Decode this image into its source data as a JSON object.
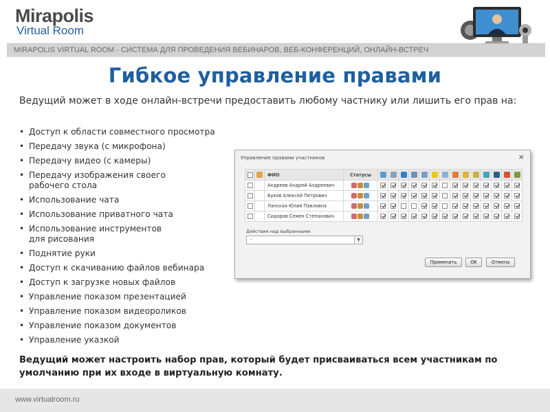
{
  "logo": {
    "line1": "Mirapolis",
    "line2": "Virtual Room"
  },
  "banner": "MIRAPOLIS VIRTUAL ROOM - СИСТЕМА ДЛЯ ПРОВЕДЕНИЯ ВЕБИНАРОВ, ВЕБ-КОНФЕРЕНЦИЙ, ОНЛАЙН-ВСТРЕЧ",
  "title": "Гибкое управление правами",
  "intro": "Ведущий может в ходе онлайн-встречи предоставить любому частнику или лишить его прав на:",
  "bullets": [
    "Доступ к области совместного просмотра",
    "Передачу звука (с микрофона)",
    "Передачу видео (с камеры)",
    "Передачу изображения своего\nрабочего стола",
    "Использование чата",
    "Использование приватного чата",
    "Использование инструментов\nдля рисования",
    "Поднятие руки",
    "Доступ к скачиванию файлов вебинара",
    "Доступ к загрузке новых файлов",
    "Управление показом презентацией",
    "Управление показом видеороликов",
    "Управление показом документов",
    "Управление указкой"
  ],
  "outro": "Ведущий может настроить набор прав, который будет присваиваться всем участникам по умолчанию при их входе в виртуальную комнату.",
  "footer": "www.virtualroom.ru",
  "dialog": {
    "title": "Управление правами участников",
    "close": "×",
    "col_name": "ФИО",
    "col_status": "Статусы",
    "header_icon_colors": [
      "#5b9bd5",
      "#8aa0b8",
      "#3b7dc4",
      "#6f93b8",
      "#7a9cc0",
      "#f0c419",
      "#8db0d6",
      "#e07b39",
      "#e3b236",
      "#c8b04a",
      "#4aa0c0",
      "#2f5d8a",
      "#d9532c",
      "#7a9c3c"
    ],
    "status_icon_colors": [
      "#d06a6a",
      "#c98b3a",
      "#6fa0c8"
    ],
    "rows": [
      {
        "name": "Андреев Андрей Андреевич",
        "checks": [
          1,
          1,
          1,
          1,
          1,
          1,
          0,
          1,
          1,
          1,
          1,
          1,
          1,
          1
        ]
      },
      {
        "name": "Буков Алексей Петрович",
        "checks": [
          1,
          1,
          1,
          1,
          1,
          1,
          0,
          1,
          1,
          1,
          1,
          1,
          1,
          1
        ]
      },
      {
        "name": "Ланская Юлия Павловна",
        "checks": [
          1,
          1,
          0,
          0,
          1,
          1,
          0,
          1,
          1,
          1,
          1,
          1,
          1,
          1
        ]
      },
      {
        "name": "Сидоров Семен Степанович",
        "checks": [
          1,
          1,
          1,
          1,
          1,
          1,
          1,
          1,
          1,
          1,
          1,
          1,
          1,
          1
        ]
      }
    ],
    "actions_label": "Действия над выбранными",
    "actions_value": "-",
    "btn_apply": "Применить",
    "btn_ok": "OK",
    "btn_cancel": "Отмена"
  }
}
